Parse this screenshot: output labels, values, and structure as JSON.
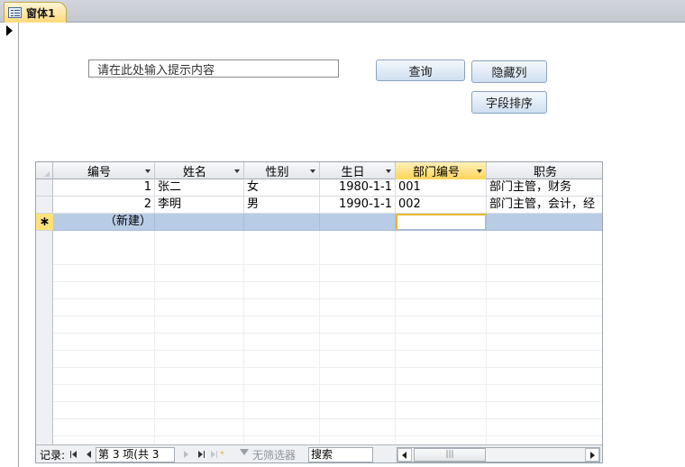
{
  "tab": {
    "title": "窗体1",
    "icon": "form-icon"
  },
  "form": {
    "prompt_input": {
      "value": "请在此处输入提示内容",
      "placeholder": ""
    },
    "query_button": "查询",
    "hide_column_button": "隐藏列",
    "sort_field_button": "字段排序"
  },
  "datasheet": {
    "columns": [
      {
        "label": "编号",
        "dropdown": true
      },
      {
        "label": "姓名",
        "dropdown": true
      },
      {
        "label": "性别",
        "dropdown": true
      },
      {
        "label": "生日",
        "dropdown": true
      },
      {
        "label": "部门编号",
        "dropdown": true,
        "active": true
      },
      {
        "label": "职务",
        "dropdown": false
      }
    ],
    "rows": [
      [
        "1",
        "张二",
        "女",
        "1980-1-1",
        "001",
        "部门主管，财务"
      ],
      [
        "2",
        "李明",
        "男",
        "1990-1-1",
        "002",
        "部门主管，会计，经"
      ]
    ],
    "new_row": {
      "selector": "∗",
      "label": "（新建）"
    }
  },
  "nav": {
    "record_label": "记录:",
    "record_position": "第 3 项(共 3 项)",
    "filter_label": "无筛选器",
    "search_placeholder": "搜索",
    "scroll_grip": "|||"
  }
}
